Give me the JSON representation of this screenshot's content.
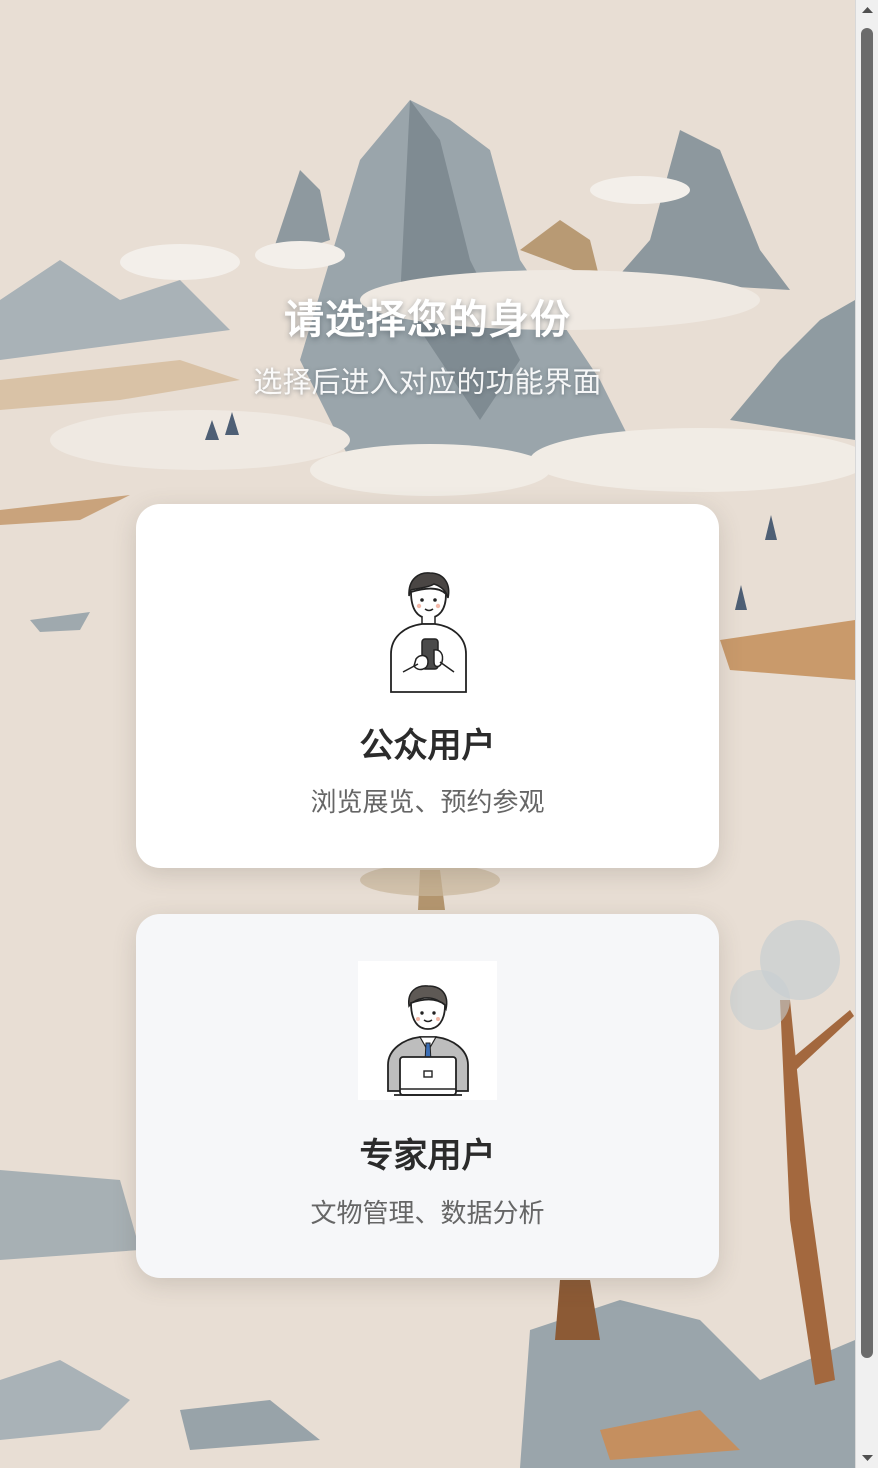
{
  "header": {
    "title": "请选择您的身份",
    "subtitle": "选择后进入对应的功能界面"
  },
  "roles": [
    {
      "title": "公众用户",
      "description": "浏览展览、预约参观",
      "icon": "person-with-phone-icon"
    },
    {
      "title": "专家用户",
      "description": "文物管理、数据分析",
      "icon": "person-with-laptop-icon"
    }
  ],
  "colors": {
    "background": "#e9e0d6",
    "card_public": "#ffffff",
    "card_expert": "#f6f7f9",
    "title_text": "#2b2b2b",
    "desc_text": "#666666"
  }
}
